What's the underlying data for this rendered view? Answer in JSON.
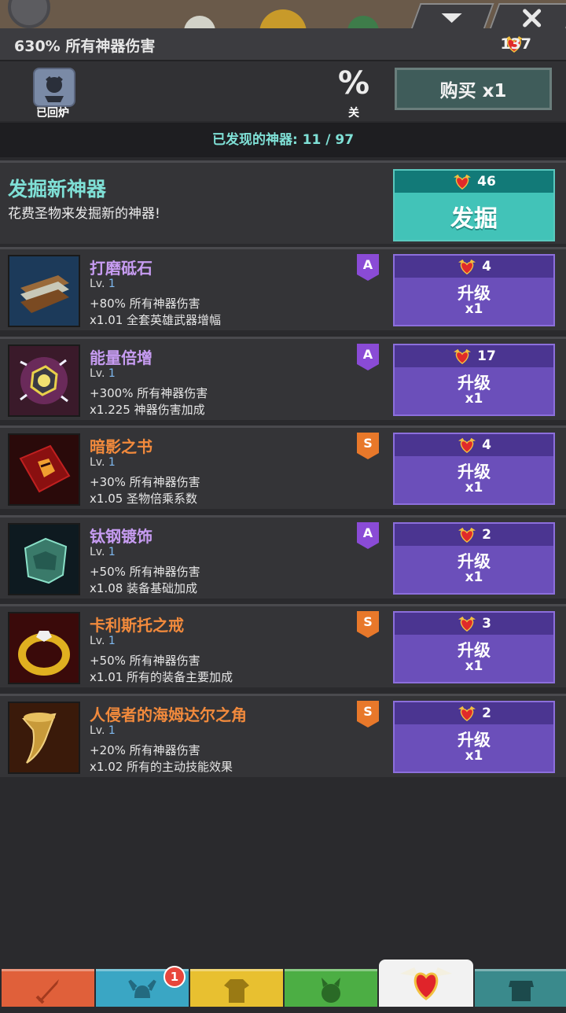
{
  "header": {
    "damage_text": "630% 所有神器伤害",
    "relics": "137"
  },
  "controls": {
    "salvage_label": "已回炉",
    "percent_symbol": "%",
    "percent_toggle_label": "关",
    "buy_label": "购买 x1"
  },
  "discovered": {
    "text": "已发现的神器: 11 / 97"
  },
  "discover": {
    "title": "发掘新神器",
    "subtitle": "花费圣物来发掘新的神器!",
    "cost": "46",
    "button_label": "发掘"
  },
  "artifacts": [
    {
      "name": "打磨砥石",
      "name_color": "#c79cf2",
      "tier": "A",
      "tier_color": "#8a4bd6",
      "lv_label": "Lv.",
      "lv": "1",
      "effect1": "+80% 所有神器伤害",
      "effect2": "x1.01 全套英雄武器增幅",
      "cost": "4",
      "up_label": "升级",
      "up_mult": "x1",
      "icon": "whetstone-icon"
    },
    {
      "name": "能量倍增",
      "name_color": "#c79cf2",
      "tier": "A",
      "tier_color": "#8a4bd6",
      "lv_label": "Lv.",
      "lv": "1",
      "effect1": "+300% 所有神器伤害",
      "effect2": "x1.225 神器伤害加成",
      "cost": "17",
      "up_label": "升级",
      "up_mult": "x1",
      "icon": "power-core-icon"
    },
    {
      "name": "暗影之书",
      "name_color": "#f28a3c",
      "tier": "S",
      "tier_color": "#e8782a",
      "lv_label": "Lv.",
      "lv": "1",
      "effect1": "+30% 所有神器伤害",
      "effect2": "x1.05 圣物倍乘系数",
      "cost": "4",
      "up_label": "升级",
      "up_mult": "x1",
      "icon": "shadow-book-icon"
    },
    {
      "name": "钛钢镀饰",
      "name_color": "#c79cf2",
      "tier": "A",
      "tier_color": "#8a4bd6",
      "lv_label": "Lv.",
      "lv": "1",
      "effect1": "+50% 所有神器伤害",
      "effect2": "x1.08 装备基础加成",
      "cost": "2",
      "up_label": "升级",
      "up_mult": "x1",
      "icon": "titanium-plating-icon"
    },
    {
      "name": "卡利斯托之戒",
      "name_color": "#f28a3c",
      "tier": "S",
      "tier_color": "#e8782a",
      "lv_label": "Lv.",
      "lv": "1",
      "effect1": "+50% 所有神器伤害",
      "effect2": "x1.01 所有的装备主要加成",
      "cost": "3",
      "up_label": "升级",
      "up_mult": "x1",
      "icon": "ring-icon"
    },
    {
      "name": "人侵者的海姆达尔之角",
      "name_color": "#f28a3c",
      "tier": "S",
      "tier_color": "#e8782a",
      "lv_label": "Lv.",
      "lv": "1",
      "effect1": "+20% 所有神器伤害",
      "effect2": "x1.02 所有的主动技能效果",
      "cost": "2",
      "up_label": "升级",
      "up_mult": "x1",
      "icon": "horn-icon"
    }
  ],
  "nav": {
    "badge_count": "1",
    "tabs": [
      {
        "name": "sword-tab",
        "color": "#e0603a",
        "icon": "sword-icon"
      },
      {
        "name": "heroes-tab",
        "color": "#3aa6c4",
        "icon": "viking-helmet-icon"
      },
      {
        "name": "equipment-tab",
        "color": "#e8c030",
        "icon": "shirt-icon"
      },
      {
        "name": "pets-tab",
        "color": "#4cae44",
        "icon": "pet-icon"
      },
      {
        "name": "artifacts-tab",
        "color": "#8a5ad6",
        "icon": "winged-heart-icon"
      },
      {
        "name": "shop-tab",
        "color": "#3a8a8c",
        "icon": "shop-icon"
      }
    ]
  }
}
